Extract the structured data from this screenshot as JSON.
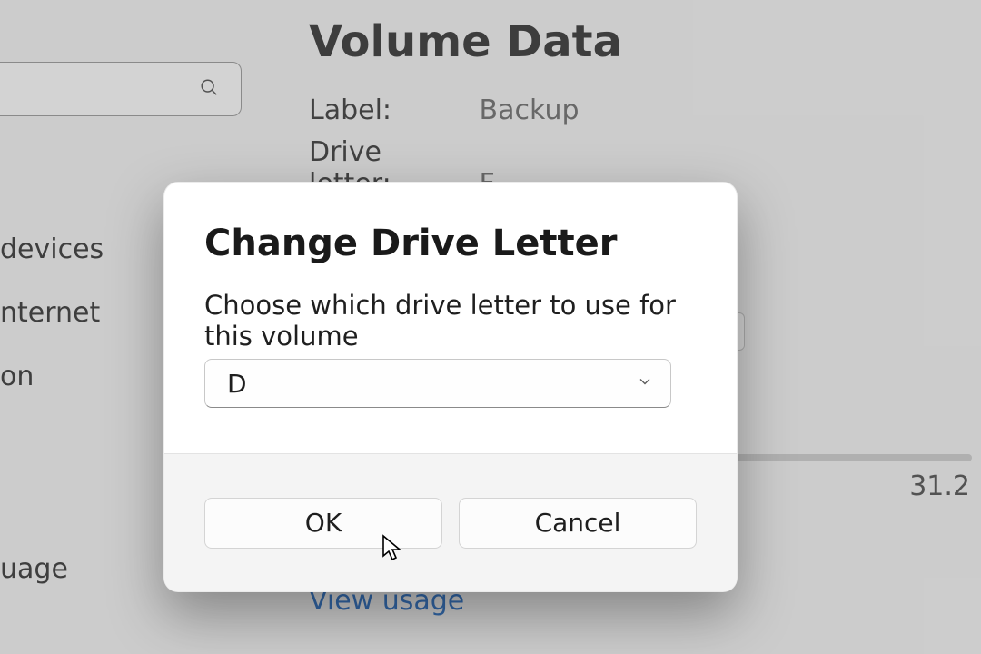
{
  "page": {
    "title": "Volume Data",
    "label_key": "Label:",
    "label_value": "Backup",
    "drive_key": "Drive letter:",
    "drive_value": "F",
    "view_usage": "View usage",
    "size_text": "31.2"
  },
  "sidebar": {
    "items": [
      {
        "label": "devices"
      },
      {
        "label": "nternet"
      },
      {
        "label": "on"
      },
      {
        "label": "uage"
      }
    ]
  },
  "search": {
    "placeholder": ""
  },
  "modal": {
    "title": "Change Drive Letter",
    "subtitle": "Choose which drive letter to use for this volume",
    "selected": "D",
    "ok_label": "OK",
    "cancel_label": "Cancel"
  }
}
